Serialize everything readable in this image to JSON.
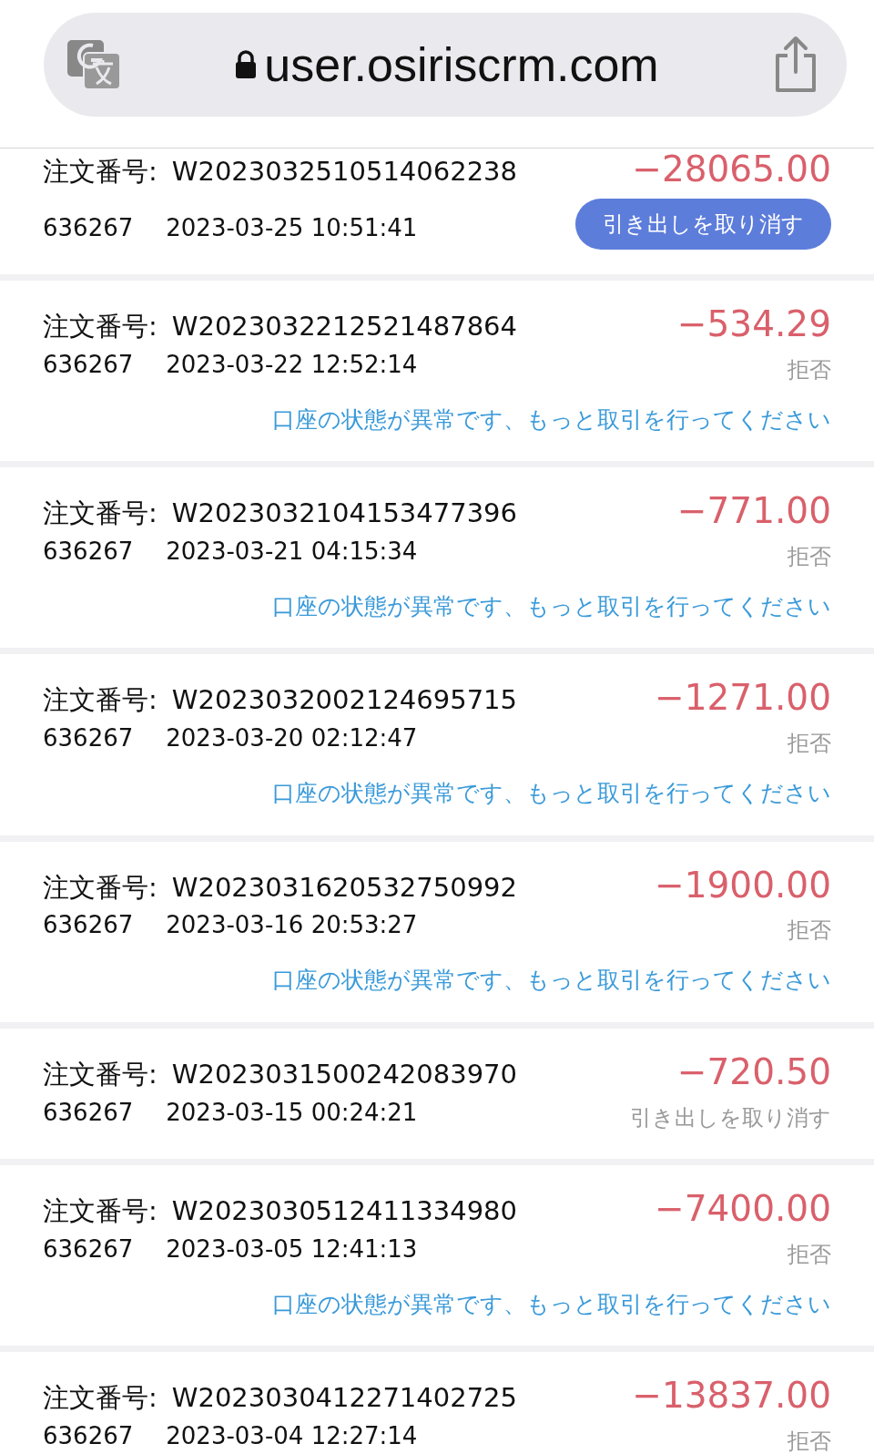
{
  "address_bar": {
    "url": "user.osiriscrm.com"
  },
  "orders": [
    {
      "label": "注文番号:",
      "order_no": "W2023032510514062238",
      "account": "636267",
      "time": "2023-03-25 10:51:41",
      "amount": "−28065.00",
      "status": {
        "kind": "button",
        "text": "引き出しを取り消す"
      }
    },
    {
      "label": "注文番号:",
      "order_no": "W2023032212521487864",
      "account": "636267",
      "time": "2023-03-22 12:52:14",
      "amount": "−534.29",
      "status": {
        "kind": "label",
        "text": "拒否"
      },
      "message": "口座の状態が異常です、もっと取引を行ってください"
    },
    {
      "label": "注文番号:",
      "order_no": "W2023032104153477396",
      "account": "636267",
      "time": "2023-03-21 04:15:34",
      "amount": "−771.00",
      "status": {
        "kind": "label",
        "text": "拒否"
      },
      "message": "口座の状態が異常です、もっと取引を行ってください"
    },
    {
      "label": "注文番号:",
      "order_no": "W2023032002124695715",
      "account": "636267",
      "time": "2023-03-20 02:12:47",
      "amount": "−1271.00",
      "status": {
        "kind": "label",
        "text": "拒否"
      },
      "message": "口座の状態が異常です、もっと取引を行ってください"
    },
    {
      "label": "注文番号:",
      "order_no": "W2023031620532750992",
      "account": "636267",
      "time": "2023-03-16 20:53:27",
      "amount": "−1900.00",
      "status": {
        "kind": "label",
        "text": "拒否"
      },
      "message": "口座の状態が異常です、もっと取引を行ってください"
    },
    {
      "label": "注文番号:",
      "order_no": "W2023031500242083970",
      "account": "636267",
      "time": "2023-03-15 00:24:21",
      "amount": "−720.50",
      "status": {
        "kind": "label",
        "text": "引き出しを取り消す"
      }
    },
    {
      "label": "注文番号:",
      "order_no": "W2023030512411334980",
      "account": "636267",
      "time": "2023-03-05 12:41:13",
      "amount": "−7400.00",
      "status": {
        "kind": "label",
        "text": "拒否"
      },
      "message": "口座の状態が異常です、もっと取引を行ってください"
    },
    {
      "label": "注文番号:",
      "order_no": "W2023030412271402725",
      "account": "636267",
      "time": "2023-03-04 12:27:14",
      "amount": "−13837.00",
      "status": {
        "kind": "label",
        "text": "拒否"
      }
    }
  ]
}
